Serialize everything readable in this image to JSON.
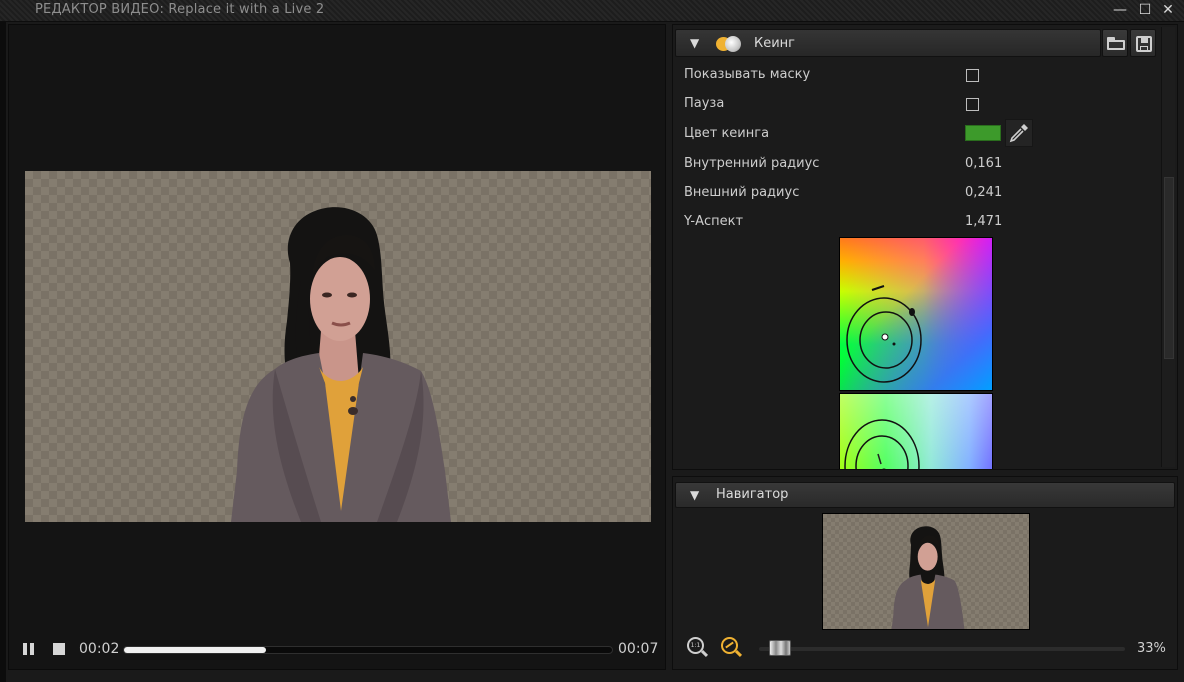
{
  "window": {
    "title": "РЕДАКТОР ВИДЕО: Replace it with a Live 2",
    "controls": {
      "minimize": "—",
      "maximize": "☐",
      "close": "✕"
    }
  },
  "player": {
    "current_time": "00:02",
    "total_time": "00:07",
    "progress_fraction": 0.29,
    "icons": {
      "pause": "pause-icon",
      "stop": "stop-icon"
    }
  },
  "keying": {
    "title": "Кеинг",
    "collapse_glyph": "▼",
    "icons": {
      "effect": "keying-effect-icon",
      "open": "folder-open-icon",
      "save": "save-icon",
      "picker": "eyedropper-icon"
    },
    "properties": {
      "show_mask": {
        "label": "Показывать маску",
        "checked": false
      },
      "pause": {
        "label": "Пауза",
        "checked": false
      },
      "key_color": {
        "label": "Цвет кеинга",
        "color": "#3d9a2b"
      },
      "inner_radius": {
        "label": "Внутренний радиус",
        "value": "0,161"
      },
      "outer_radius": {
        "label": "Внешний радиус",
        "value": "0,241"
      },
      "y_aspect": {
        "label": "Y-Аспект",
        "value": "1,471"
      }
    }
  },
  "navigator": {
    "title": "Навигатор",
    "collapse_glyph": "▼",
    "zoom_label": "33%",
    "zoom_fraction": 0.03,
    "icons": {
      "fit": "zoom-fit-icon",
      "auto": "zoom-auto-icon"
    },
    "fit_glyph": "1:1"
  },
  "colors": {
    "accent": "#f0b232",
    "key_green": "#3d9a2b",
    "panel_bg": "#1b1b1b"
  }
}
